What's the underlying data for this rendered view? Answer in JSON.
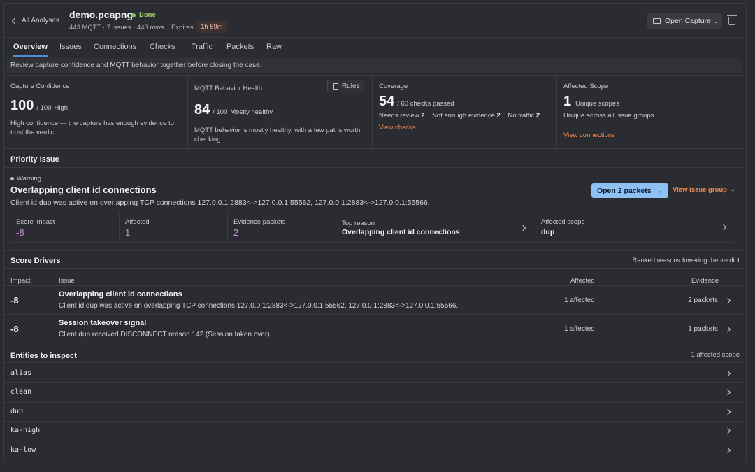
{
  "header": {
    "back_label": "All Analyses",
    "file_name": "demo.pcapng",
    "status": "Done",
    "meta": "443 MQTT · 7 issues · 443 rows",
    "expires_label": "Expires",
    "expires_value": "1h 59m",
    "open_capture": "Open Capture..."
  },
  "tabs": [
    "Overview",
    "Issues",
    "Connections",
    "Checks",
    "Traffic",
    "Packets",
    "Raw"
  ],
  "banner": "Review capture confidence and MQTT behavior together before closing the case.",
  "cards": {
    "confidence": {
      "title": "Capture Confidence",
      "value": "100",
      "out_of": "/ 100",
      "label": "High",
      "desc": "High confidence — the capture has enough evidence to trust the verdict."
    },
    "health": {
      "title": "MQTT Behavior Health",
      "rules": "Rules",
      "value": "84",
      "out_of": "/ 100",
      "label": "Mostly healthy",
      "desc": "MQTT behavior is mostly healthy, with a few paths worth checking."
    },
    "coverage": {
      "title": "Coverage",
      "value": "54",
      "out_of": "/ 60 checks passed",
      "needs_review_label": "Needs review",
      "needs_review": "2",
      "not_enough_label": "Not enough evidence",
      "not_enough": "2",
      "no_traffic_label": "No traffic",
      "no_traffic": "2",
      "link": "View checks"
    },
    "scope": {
      "title": "Affected Scope",
      "value": "1",
      "label": "Unique scopes",
      "desc": "Unique across all issue groups",
      "link": "View connections"
    }
  },
  "priority": {
    "section_title": "Priority Issue",
    "severity": "Warning",
    "title": "Overlapping client id connections",
    "desc": "Client id dup was active on overlapping TCP connections 127.0.0.1:2883<->127.0.0.1:55562, 127.0.0.1:2883<->127.0.0.1:55566.",
    "open_button": "Open 2 packets",
    "view_group": "View issue group",
    "stats": {
      "score_impact_label": "Score impact",
      "score_impact": "-8",
      "affected_label": "Affected",
      "affected": "1",
      "evidence_label": "Evidence packets",
      "evidence": "2",
      "top_reason_label": "Top reason",
      "top_reason": "Overlapping client id connections",
      "affected_scope_label": "Affected scope",
      "affected_scope": "dup"
    }
  },
  "score_drivers": {
    "title": "Score Drivers",
    "subtitle": "Ranked reasons lowering the verdict",
    "columns": {
      "impact": "Impact",
      "issue": "Issue",
      "affected": "Affected",
      "evidence": "Evidence"
    },
    "rows": [
      {
        "impact": "-8",
        "title": "Overlapping client id connections",
        "desc": "Client id dup was active on overlapping TCP connections 127.0.0.1:2883<->127.0.0.1:55562, 127.0.0.1:2883<->127.0.0.1:55566.",
        "affected": "1 affected",
        "evidence": "2 packets"
      },
      {
        "impact": "-8",
        "title": "Session takeover signal",
        "desc": "Client dup received DISCONNECT reason 142 (Session taken over).",
        "affected": "1 affected",
        "evidence": "1 packets"
      }
    ]
  },
  "entities": {
    "title": "Entities to inspect",
    "subtitle": "1 affected scope",
    "items": [
      "alias",
      "clean",
      "dup",
      "ka-high",
      "ka-low"
    ]
  },
  "colors": {
    "accent": "#8dc1f3",
    "link": "#ef8a4f",
    "done": "#9fcf6d",
    "impact_value": "#c98fd6"
  }
}
